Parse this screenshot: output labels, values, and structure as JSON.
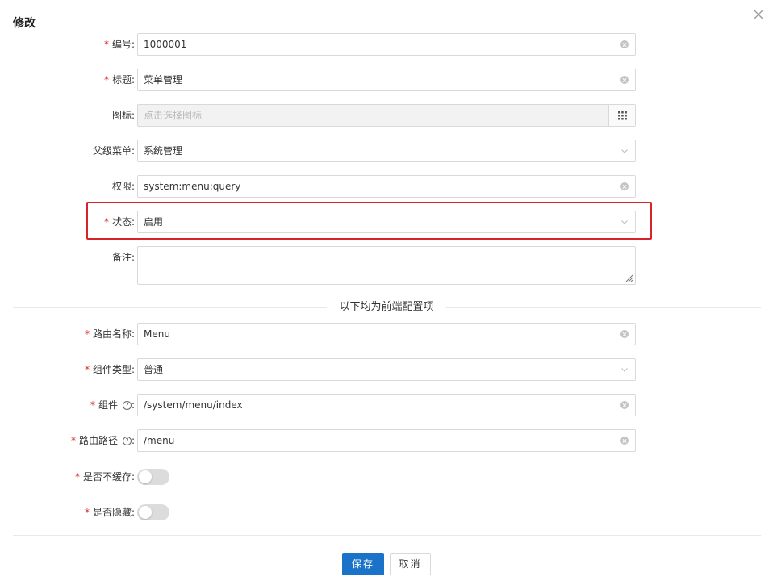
{
  "dialog": {
    "title": "修改"
  },
  "form": {
    "code": {
      "label": "编号",
      "value": "1000001"
    },
    "title": {
      "label": "标题",
      "value": "菜单管理"
    },
    "icon": {
      "label": "图标",
      "placeholder": "点击选择图标"
    },
    "parent_menu": {
      "label": "父级菜单",
      "value": "系统管理"
    },
    "permission": {
      "label": "权限",
      "value": "system:menu:query"
    },
    "status": {
      "label": "状态",
      "value": "启用"
    },
    "remark": {
      "label": "备注",
      "value": ""
    },
    "divider_text": "以下均为前端配置项",
    "route_name": {
      "label": "路由名称",
      "value": "Menu"
    },
    "component_type": {
      "label": "组件类型",
      "value": "普通"
    },
    "component": {
      "label": "组件",
      "value": "/system/menu/index"
    },
    "route_path": {
      "label": "路由路径",
      "value": "/menu"
    },
    "no_cache": {
      "label": "是否不缓存",
      "on": false
    },
    "hidden": {
      "label": "是否隐藏",
      "on": false
    }
  },
  "buttons": {
    "save": "保存",
    "cancel": "取消"
  },
  "colors": {
    "primary": "#1a73c8",
    "required": "#e02020",
    "highlight": "#d9232b"
  },
  "icons": {
    "close": "close-icon",
    "clear": "clear-icon",
    "dropdown": "chevron-down-icon",
    "icon_picker": "grid-icon",
    "help": "question-circle-icon"
  }
}
